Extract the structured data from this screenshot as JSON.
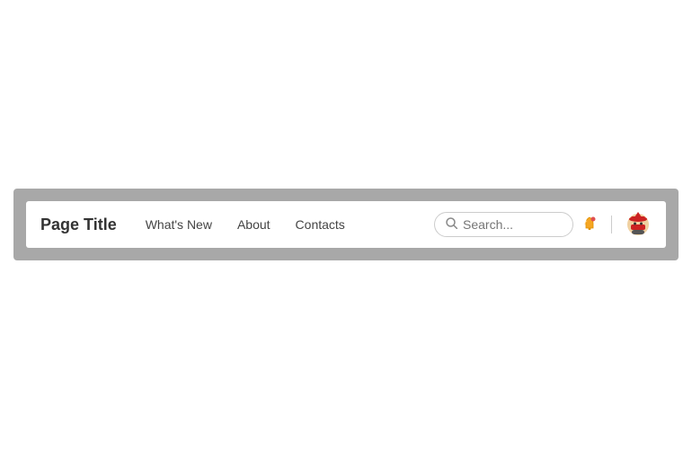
{
  "navbar": {
    "brand": "Page Title",
    "links": [
      {
        "id": "whats-new",
        "label": "What's New"
      },
      {
        "id": "about",
        "label": "About"
      },
      {
        "id": "contacts",
        "label": "Contacts"
      }
    ],
    "search": {
      "placeholder": "Search...",
      "value": ""
    },
    "icons": {
      "search": "🔍",
      "bell": "🔔",
      "avatar": "🤺"
    }
  },
  "colors": {
    "background_outer": "#a8a8a8",
    "navbar_bg": "#ffffff",
    "text_brand": "#333333",
    "text_link": "#444444",
    "divider": "#cccccc"
  }
}
